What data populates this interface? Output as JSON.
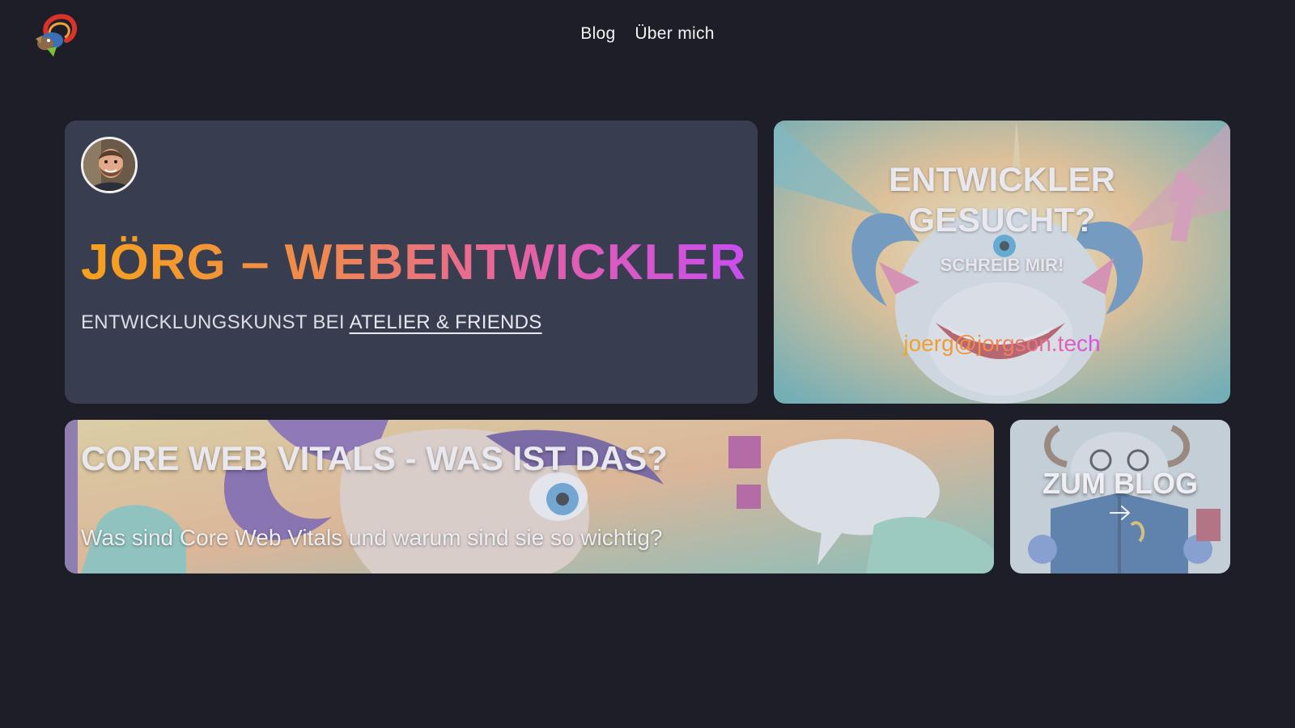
{
  "nav": {
    "items": [
      {
        "label": "Blog"
      },
      {
        "label": "Über mich"
      }
    ]
  },
  "hero": {
    "title": "JÖRG – WEBENTWICKLER",
    "subtitle_prefix": "ENTWICKLUNGSKUNST BEI",
    "subtitle_link": "ATELIER & FRIENDS"
  },
  "contact": {
    "title_line1": "ENTWICKLER",
    "title_line2": "GESUCHT?",
    "subtitle": "SCHREIB MIR!",
    "email": "joerg@jorgson.tech"
  },
  "article": {
    "title": "CORE WEB VITALS - WAS IST DAS?",
    "description": "Was sind Core Web Vitals und warum sind sie so wichtig?"
  },
  "blog": {
    "title": "ZUM BLOG",
    "arrow_icon": "arrow-right-icon"
  },
  "colors": {
    "background": "#1e1e28",
    "card": "#393d50",
    "gradient_start": "#f7a21b",
    "gradient_end": "#c94df0"
  }
}
